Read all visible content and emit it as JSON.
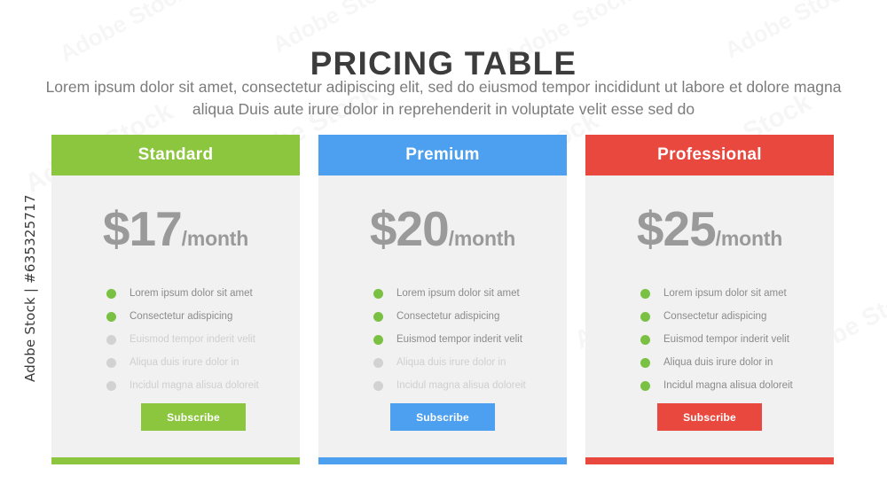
{
  "watermark": {
    "side_label": "Adobe Stock | #635325717",
    "tiles": [
      "Adobe Stock",
      "Adobe Stock",
      "Adobe Stock",
      "Adobe Stock",
      "Adobe Stock",
      "Adobe Stock",
      "Adobe Stock",
      "Adobe Stock",
      "Adobe Stock",
      "Adobe Stock",
      "Adobe Stock",
      "Adobe Stock"
    ]
  },
  "header": {
    "title": "PRICING TABLE",
    "subtitle": "Lorem ipsum dolor sit amet, consectetur adipiscing elit, sed do eiusmod tempor incididunt ut labore et dolore magna aliqua Duis aute irure dolor in reprehenderit in voluptate velit esse sed do"
  },
  "colors": {
    "green": "#8cc63e",
    "blue": "#4d9fef",
    "red": "#e9483e",
    "card_body": "#f1f1f1",
    "dot_on": "#7ac143",
    "dot_off": "#d2d2d2",
    "price_text": "#9a9a9a",
    "feature_text": "#8b8b8b",
    "feature_text_muted": "#cfcfcf",
    "title_text": "#3c3c3c",
    "subtitle_text": "#7c7c7c"
  },
  "plans": [
    {
      "name": "Standard",
      "accent": "#8cc63e",
      "price_amount": "$17",
      "price_period": "/month",
      "features": [
        {
          "label": "Lorem ipsum dolor sit amet",
          "included": true
        },
        {
          "label": "Consectetur adispicing",
          "included": true
        },
        {
          "label": "Euismod tempor inderit velit",
          "included": false
        },
        {
          "label": "Aliqua duis irure dolor in",
          "included": false
        },
        {
          "label": "Incidul magna alisua doloreit",
          "included": false
        }
      ],
      "button_label": "Subscribe"
    },
    {
      "name": "Premium",
      "accent": "#4d9fef",
      "price_amount": "$20",
      "price_period": "/month",
      "features": [
        {
          "label": "Lorem ipsum dolor sit amet",
          "included": true
        },
        {
          "label": "Consectetur adispicing",
          "included": true
        },
        {
          "label": "Euismod tempor inderit velit",
          "included": true
        },
        {
          "label": "Aliqua duis irure dolor in",
          "included": false
        },
        {
          "label": "Incidul magna alisua doloreit",
          "included": false
        }
      ],
      "button_label": "Subscribe"
    },
    {
      "name": "Professional",
      "accent": "#e9483e",
      "price_amount": "$25",
      "price_period": "/month",
      "features": [
        {
          "label": "Lorem ipsum dolor sit amet",
          "included": true
        },
        {
          "label": "Consectetur adispicing",
          "included": true
        },
        {
          "label": "Euismod tempor inderit velit",
          "included": true
        },
        {
          "label": "Aliqua duis irure dolor in",
          "included": true
        },
        {
          "label": "Incidul magna alisua doloreit",
          "included": true
        }
      ],
      "button_label": "Subscribe"
    }
  ]
}
